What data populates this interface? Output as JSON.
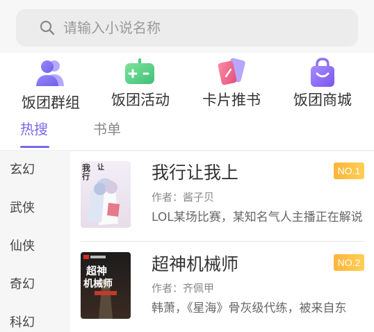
{
  "search": {
    "placeholder": "请输入小说名称",
    "icon": "search-icon"
  },
  "nav": [
    {
      "label": "饭团群组",
      "icon": "group-icon",
      "color": "#7b74ee"
    },
    {
      "label": "饭团活动",
      "icon": "gamepad-icon",
      "color": "#5fd38a"
    },
    {
      "label": "卡片推书",
      "icon": "cards-icon",
      "color": "#f06a8a"
    },
    {
      "label": "饭团商城",
      "icon": "shopping-bag-icon",
      "color": "#8a6df2"
    }
  ],
  "tabs": [
    {
      "label": "热搜",
      "active": true
    },
    {
      "label": "书单",
      "active": false
    }
  ],
  "categories": [
    "玄幻",
    "武侠",
    "仙侠",
    "奇幻",
    "科幻"
  ],
  "books": [
    {
      "title": "我行让我上",
      "author": "作者：酱子贝",
      "desc": "LOL某场比赛，某知名气人主播正在解说",
      "rank": "NO.1"
    },
    {
      "title": "超神机械师",
      "author": "作者：齐佩甲",
      "desc": "韩萧，《星海》骨灰级代练，被来自东",
      "rank": "NO.2"
    }
  ],
  "covers": {
    "book1_text": "我行让我上",
    "book2_text": "超神机械师"
  },
  "accent": "#7a68ee",
  "badge_color": "#ffb43a"
}
